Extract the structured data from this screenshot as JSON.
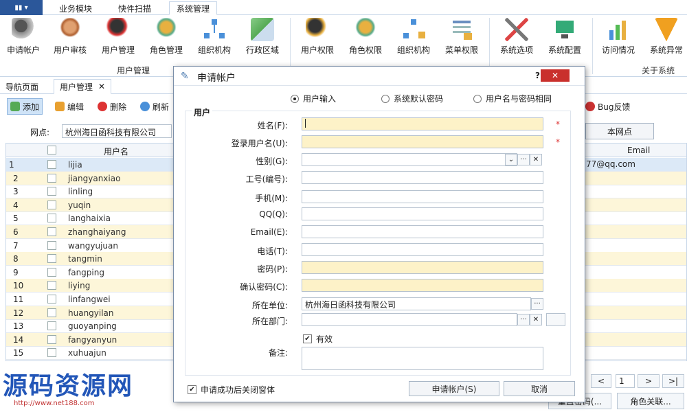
{
  "ribbon_tabs": [
    "业务模块",
    "快件扫描",
    "系统管理"
  ],
  "ribbon": {
    "group1": {
      "label": "用户管理",
      "buttons": [
        "申请帐户",
        "用户审核",
        "用户管理",
        "角色管理",
        "组织机构",
        "行政区域"
      ]
    },
    "group2": {
      "buttons": [
        "用户权限",
        "角色权限",
        "组织机构",
        "菜单权限"
      ]
    },
    "group3": {
      "buttons": [
        "系统选项",
        "系统配置"
      ]
    },
    "group4": {
      "label": "关于系统",
      "buttons": [
        "访问情况",
        "系统异常"
      ]
    }
  },
  "doc_tabs": [
    "导航页面",
    "用户管理"
  ],
  "toolbar": {
    "add": "添加",
    "edit": "编辑",
    "delete": "删除",
    "refresh": "刷新",
    "bug": "Bug反馈"
  },
  "site": {
    "label": "网点:",
    "value": "杭州海日函科技有限公司",
    "button": "本网点"
  },
  "grid": {
    "col_username": "用户名",
    "col_email": "Email",
    "email_first": "77@qq.com",
    "rows": [
      {
        "num": "1",
        "name": "lijia"
      },
      {
        "num": "2",
        "name": "jiangyanxiao"
      },
      {
        "num": "3",
        "name": "linling"
      },
      {
        "num": "4",
        "name": "yuqin"
      },
      {
        "num": "5",
        "name": "langhaixia"
      },
      {
        "num": "6",
        "name": "zhanghaiyang"
      },
      {
        "num": "7",
        "name": "wangyujuan"
      },
      {
        "num": "8",
        "name": "tangmin"
      },
      {
        "num": "9",
        "name": "fangping"
      },
      {
        "num": "10",
        "name": "liying"
      },
      {
        "num": "11",
        "name": "linfangwei"
      },
      {
        "num": "12",
        "name": "huangyilan"
      },
      {
        "num": "13",
        "name": "guoyanping"
      },
      {
        "num": "14",
        "name": "fangyanyun"
      },
      {
        "num": "15",
        "name": "xuhuajun"
      }
    ]
  },
  "pager": {
    "page": "1",
    "prev": "<",
    "next": ">",
    "last": ">|"
  },
  "bottom_buttons": {
    "b1": "重置密码(...",
    "b2": "角色关联..."
  },
  "watermark": {
    "text": "源码资源网",
    "url": "http://www.net188.com"
  },
  "dialog": {
    "title": "申请帐户",
    "help": "?",
    "close": "✕",
    "radios": [
      "用户输入",
      "系统默认密码",
      "用户名与密码相同"
    ],
    "group": "用户",
    "labels": {
      "name": "姓名(F):",
      "login": "登录用户名(U):",
      "gender": "性别(G):",
      "code": "工号(编号):",
      "mobile": "手机(M):",
      "qq": "QQ(Q):",
      "email": "Email(E):",
      "phone": "电话(T):",
      "password": "密码(P):",
      "confirm": "确认密码(C):",
      "company": "所在单位:",
      "dept": "所在部门:",
      "valid": "有效",
      "remark": "备注:"
    },
    "company_value": "杭州海日函科技有限公司",
    "required_star": "*",
    "close_after": "申请成功后关闭窗体",
    "submit": "申请帐户(S)",
    "cancel": "取消"
  }
}
